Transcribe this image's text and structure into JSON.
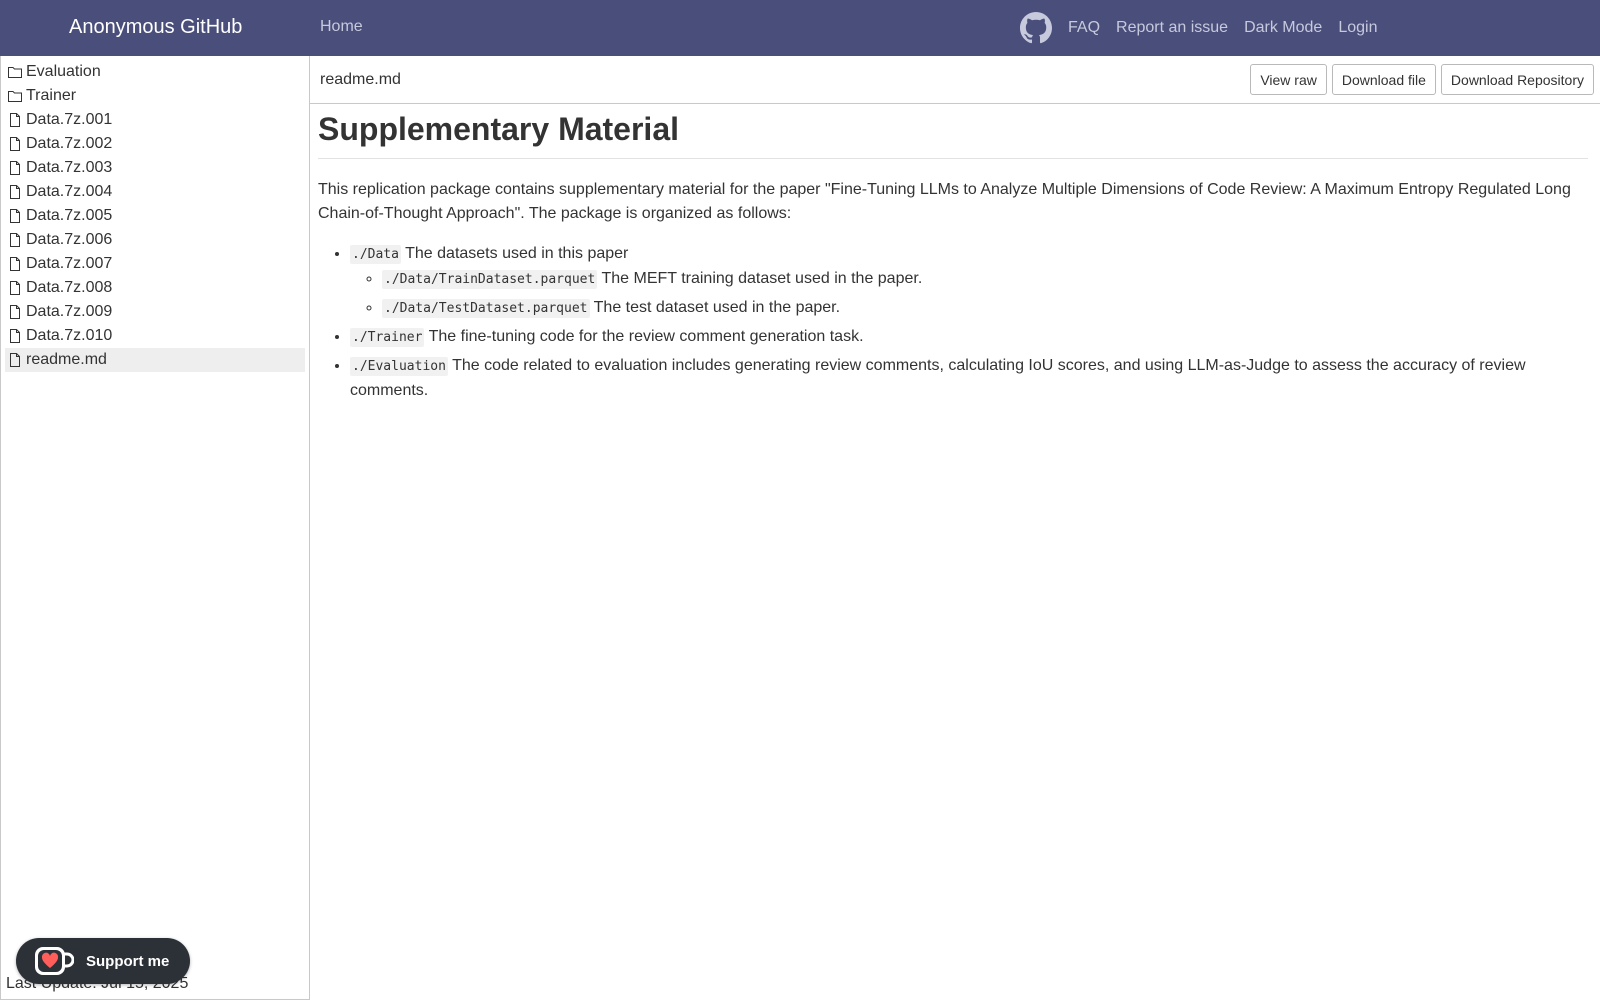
{
  "navbar": {
    "brand": "Anonymous GitHub",
    "home": "Home",
    "github_icon": "github-icon",
    "links": {
      "faq": "FAQ",
      "report": "Report an issue",
      "dark_mode": "Dark Mode",
      "login": "Login"
    }
  },
  "sidebar": {
    "items": [
      {
        "type": "folder",
        "icon": "folder-icon",
        "label": "Evaluation"
      },
      {
        "type": "folder",
        "icon": "folder-icon",
        "label": "Trainer"
      },
      {
        "type": "file",
        "icon": "file-icon",
        "label": "Data.7z.001"
      },
      {
        "type": "file",
        "icon": "file-icon",
        "label": "Data.7z.002"
      },
      {
        "type": "file",
        "icon": "file-icon",
        "label": "Data.7z.003"
      },
      {
        "type": "file",
        "icon": "file-icon",
        "label": "Data.7z.004"
      },
      {
        "type": "file",
        "icon": "file-icon",
        "label": "Data.7z.005"
      },
      {
        "type": "file",
        "icon": "file-icon",
        "label": "Data.7z.006"
      },
      {
        "type": "file",
        "icon": "file-icon",
        "label": "Data.7z.007"
      },
      {
        "type": "file",
        "icon": "file-icon",
        "label": "Data.7z.008"
      },
      {
        "type": "file",
        "icon": "file-icon",
        "label": "Data.7z.009"
      },
      {
        "type": "file",
        "icon": "file-icon",
        "label": "Data.7z.010"
      },
      {
        "type": "file",
        "icon": "file-icon",
        "label": "readme.md",
        "active": true
      }
    ],
    "last_update": "Last Update: Jul 15, 2025",
    "support": {
      "label": "Support me",
      "icon": "kofi-cup-icon"
    }
  },
  "file_view": {
    "file_name": "readme.md",
    "buttons": {
      "view_raw": "View raw",
      "download_file": "Download file",
      "download_repo": "Download Repository"
    }
  },
  "readme": {
    "title": "Supplementary Material",
    "intro": "This replication package contains supplementary material for the paper \"Fine-Tuning LLMs to Analyze Multiple Dimensions of Code Review: A Maximum Entropy Regulated Long Chain-of-Thought Approach\". The package is organized as follows:",
    "items": [
      {
        "code": "./Data",
        "text": " The datasets used in this paper",
        "children": [
          {
            "code": "./Data/TrainDataset.parquet",
            "text": " The MEFT training dataset used in the paper."
          },
          {
            "code": "./Data/TestDataset.parquet",
            "text": " The test dataset used in the paper."
          }
        ]
      },
      {
        "code": "./Trainer",
        "text": " The fine-tuning code for the review comment generation task."
      },
      {
        "code": "./Evaluation",
        "text": " The code related to evaluation includes generating review comments, calculating IoU scores, and using LLM-as-Judge to assess the accuracy of review comments."
      }
    ]
  },
  "colors": {
    "navbar_bg": "#4a4e7a",
    "nav_link": "#c7c9dd",
    "active_item_bg": "#eeeeee",
    "support_bg": "#2c3138",
    "kofi_heart": "#ff5e5b"
  }
}
